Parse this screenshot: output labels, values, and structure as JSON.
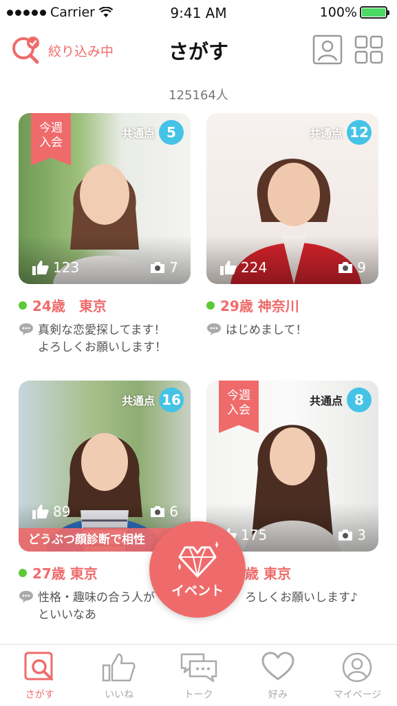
{
  "status_bar": {
    "carrier": "Carrier",
    "time": "9:41 AM",
    "battery": "100%"
  },
  "header": {
    "filter_label": "絞り込み中",
    "title": "さがす"
  },
  "result_count": "125164人",
  "cards": [
    {
      "ribbon": "今週\n入会",
      "common_label": "共通点",
      "common_count": "5",
      "likes": "123",
      "photos": "7",
      "age_city": "24歳　東京",
      "message": "真剣な恋愛探してます！\nよろしくお願いします！",
      "banner": ""
    },
    {
      "ribbon": "",
      "common_label": "共通点",
      "common_count": "12",
      "likes": "224",
      "photos": "9",
      "age_city": "29歳 神奈川",
      "message": "はじめまして！",
      "banner": ""
    },
    {
      "ribbon": "",
      "common_label": "共通点",
      "common_count": "16",
      "likes": "89",
      "photos": "6",
      "age_city": "27歳 東京",
      "message": "性格・趣味の合う人が\nといいなあ",
      "banner": "どうぶつ顔診断で相性"
    },
    {
      "ribbon": "今週\n入会",
      "common_label": "共通点",
      "common_count": "8",
      "likes": "175",
      "photos": "3",
      "age_city": "歳 東京",
      "message": "ろしくお願いします♪",
      "banner": ""
    }
  ],
  "event_button": {
    "label": "イベント"
  },
  "tabs": [
    {
      "label": "さがす",
      "icon": "search-tab-icon",
      "active": true
    },
    {
      "label": "いいね",
      "icon": "thumbs-up-icon",
      "active": false
    },
    {
      "label": "トーク",
      "icon": "chat-icon",
      "active": false
    },
    {
      "label": "好み",
      "icon": "heart-icon",
      "active": false
    },
    {
      "label": "マイページ",
      "icon": "user-icon",
      "active": false
    }
  ],
  "colors": {
    "accent": "#ef6b6b",
    "badge": "#45c3e6",
    "online": "#5cc935"
  }
}
